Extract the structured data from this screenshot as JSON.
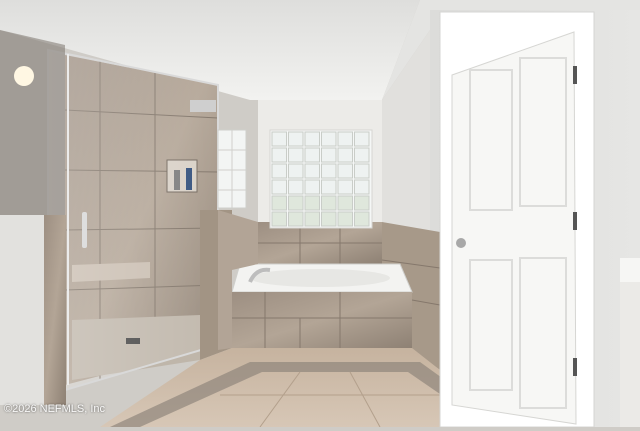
{
  "photo": {
    "watermark": "©2026 NEFMLS, Inc",
    "colors": {
      "ceiling": "#ebebea",
      "wall": "#e9e8e4",
      "tile": "#a89a8c",
      "tile_dark": "#8c7e71",
      "floor": "#cbb9a6",
      "door": "#f5f5f3",
      "tub": "#f3f3f1"
    }
  }
}
